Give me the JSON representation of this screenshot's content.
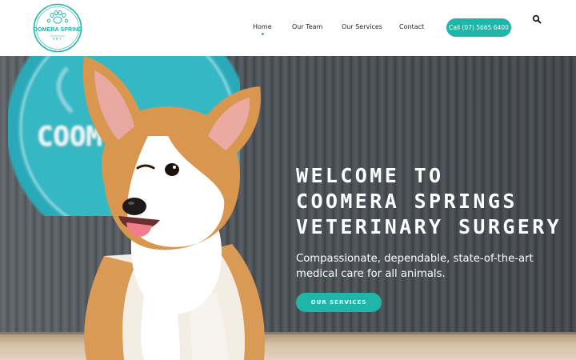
{
  "brand": {
    "logo_text_top": "COOMERA SPRINGS",
    "logo_text_bottom": "VET",
    "accent_color": "#1fb5a8"
  },
  "nav": {
    "items": [
      {
        "label": "Home",
        "active": true
      },
      {
        "label": "Our Team",
        "active": false
      },
      {
        "label": "Our Services",
        "active": false
      },
      {
        "label": "Contact",
        "active": false
      }
    ],
    "call_button": "Call (07) 5665 6400",
    "search_icon": "search-icon"
  },
  "hero": {
    "title_lines": [
      "WELCOME TO",
      "COOMERA SPRINGS",
      "VETERINARY SURGERY"
    ],
    "subtitle": "Compassionate, dependable, state-of-the-art medical care for all animals.",
    "button_label": "OUR SERVICES",
    "sign_text": "COOM"
  }
}
